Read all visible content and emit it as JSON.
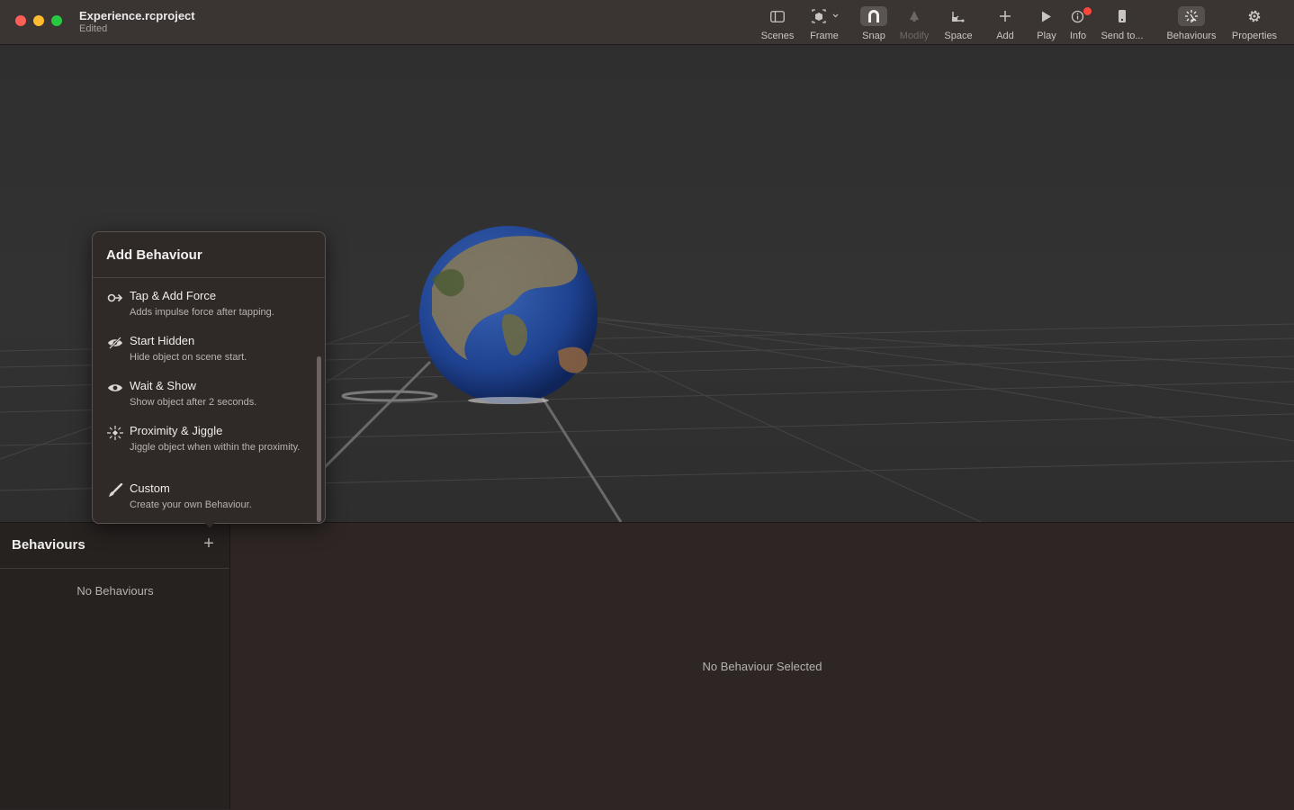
{
  "window": {
    "title": "Experience.rcproject",
    "subtitle": "Edited"
  },
  "toolbar": {
    "items": [
      {
        "label": "Scenes",
        "icon": "sidebar-icon"
      },
      {
        "label": "Frame",
        "icon": "frame-icon"
      },
      {
        "label": "Snap",
        "icon": "magnet-icon"
      },
      {
        "label": "Modify",
        "icon": "modify-icon"
      },
      {
        "label": "Space",
        "icon": "space-icon"
      },
      {
        "label": "Add",
        "icon": "plus-icon"
      },
      {
        "label": "Play",
        "icon": "play-icon"
      },
      {
        "label": "Info",
        "icon": "info-icon"
      },
      {
        "label": "Send to...",
        "icon": "device-icon"
      },
      {
        "label": "Behaviours",
        "icon": "behaviours-icon"
      },
      {
        "label": "Properties",
        "icon": "gear-icon"
      }
    ]
  },
  "popover": {
    "title": "Add Behaviour",
    "items": [
      {
        "title": "Tap & Add Force",
        "desc": "Adds impulse force after tapping.",
        "icon": "tap-force-icon"
      },
      {
        "title": "Start Hidden",
        "desc": "Hide object on scene start.",
        "icon": "eye-slash-icon"
      },
      {
        "title": "Wait & Show",
        "desc": "Show object after 2 seconds.",
        "icon": "eye-icon"
      },
      {
        "title": "Proximity & Jiggle",
        "desc": "Jiggle object when within the proximity.",
        "icon": "jiggle-icon"
      },
      {
        "title": "Custom",
        "desc": "Create your own Behaviour.",
        "icon": "brush-icon"
      }
    ]
  },
  "behaviours_panel": {
    "title": "Behaviours",
    "add_label": "+",
    "empty_text": "No Behaviours"
  },
  "detail_panel": {
    "empty_text": "No Behaviour Selected"
  },
  "colors": {
    "close": "#fe5f57",
    "minimize": "#febc2e",
    "zoom": "#28c840",
    "badge": "#ff453a"
  }
}
